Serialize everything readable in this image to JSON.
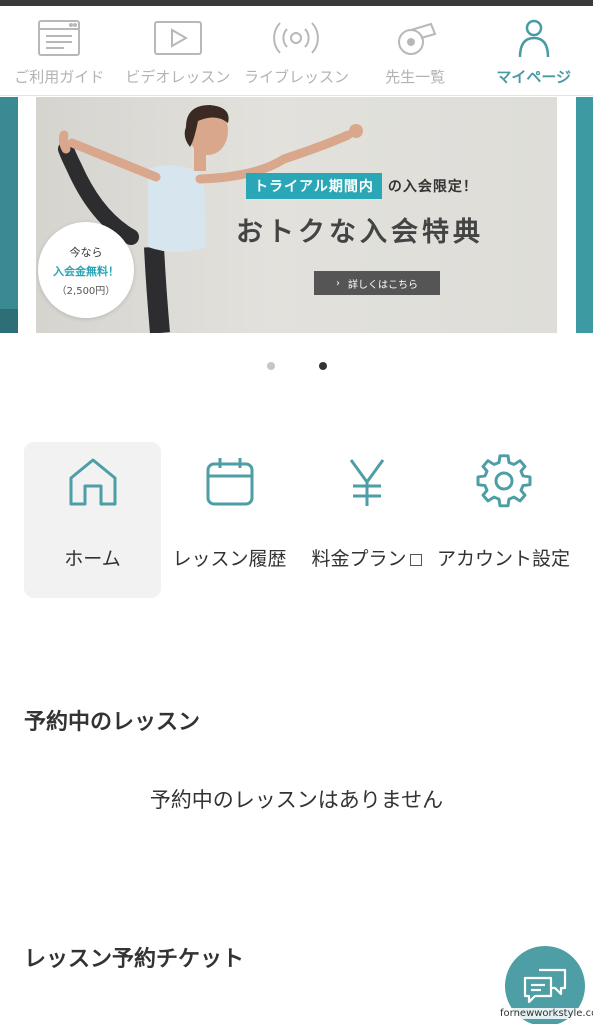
{
  "topnav": {
    "items": [
      {
        "label": "ご利用ガイド",
        "icon": "guide-icon"
      },
      {
        "label": "ビデオレッスン",
        "icon": "video-play-icon"
      },
      {
        "label": "ライブレッスン",
        "icon": "live-broadcast-icon"
      },
      {
        "label": "先生一覧",
        "icon": "whistle-icon"
      },
      {
        "label": "マイページ",
        "icon": "person-icon",
        "active": true
      }
    ]
  },
  "banner": {
    "badge": {
      "line1": "今なら",
      "line2": "入会金無料！",
      "line3": "（2,500円）"
    },
    "tag": "トライアル期間内",
    "tag_suffix": "の入会限定！",
    "title": "おトクな入会特典",
    "button": "詳しくはこちら",
    "slide_count": 2,
    "active_slide": 2
  },
  "menu": {
    "items": [
      {
        "label": "ホーム",
        "icon": "home-icon",
        "active": true
      },
      {
        "label": "レッスン履歴",
        "icon": "calendar-icon"
      },
      {
        "label": "料金プラン",
        "icon": "yen-icon",
        "external": true
      },
      {
        "label": "アカウント設定",
        "icon": "gear-icon"
      }
    ]
  },
  "sections": {
    "reserved_title": "予約中のレッスン",
    "reserved_empty": "予約中のレッスンはありません",
    "ticket_title": "レッスン予約チケット"
  },
  "chat": {
    "icon": "chat-bubbles-icon"
  },
  "watermark": "fornewworkstyle.com",
  "colors": {
    "accent": "#4a9aa3",
    "tag": "#2aa7b6",
    "inactive": "#b3b3b3"
  }
}
